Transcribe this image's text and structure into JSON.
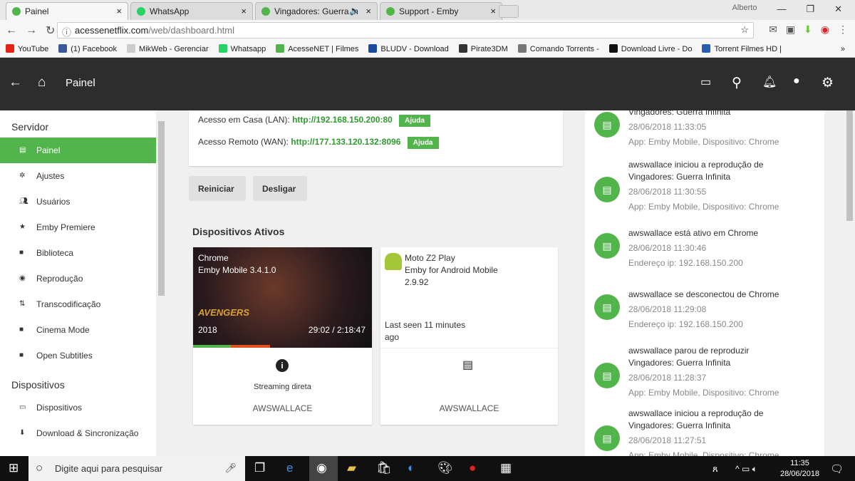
{
  "browser": {
    "tabs": [
      {
        "label": "Painel",
        "color": "#52b54b"
      },
      {
        "label": "WhatsApp",
        "color": "#25d366"
      },
      {
        "label": "Vingadores: Guerra In",
        "color": "#52b54b",
        "audio": "🔈"
      },
      {
        "label": "Support - Emby",
        "color": "#52b54b"
      }
    ],
    "user": "Alberto",
    "url_host": "acessenetflix.com",
    "url_path": "/web/dashboard.html",
    "bookmarks": [
      {
        "label": "YouTube",
        "color": "#e62117"
      },
      {
        "label": "(1) Facebook",
        "color": "#3b5998"
      },
      {
        "label": "MikWeb - Gerenciar",
        "color": "#ccc"
      },
      {
        "label": "Whatsapp",
        "color": "#25d366"
      },
      {
        "label": "AcesseNET | Filmes",
        "color": "#52b54b"
      },
      {
        "label": "BLUDV - Download",
        "color": "#1a4aa0"
      },
      {
        "label": "Pirate3DM",
        "color": "#333"
      },
      {
        "label": "Comando Torrents -",
        "color": "#777"
      },
      {
        "label": "Download Livre - Do",
        "color": "#111"
      },
      {
        "label": "Torrent Filmes HD |",
        "color": "#2a5db0"
      }
    ],
    "more": "»"
  },
  "header": {
    "title": "Painel"
  },
  "sidebar": {
    "server_heading": "Servidor",
    "server_items": [
      "Painel",
      "Ajustes",
      "Usuários",
      "Emby Premiere",
      "Biblioteca",
      "Reprodução",
      "Transcodificação",
      "Cinema Mode",
      "Open Subtitles"
    ],
    "devices_heading": "Dispositivos",
    "device_items": [
      "Dispositivos",
      "Download & Sincronização"
    ]
  },
  "server": {
    "lan_label": "Acesso em Casa (LAN):",
    "lan_url": "http://192.168.150.200:80",
    "wan_label": "Acesso Remoto (WAN):",
    "wan_url": "http://177.133.120.132:8096",
    "help": "Ajuda",
    "restart": "Reiniciar",
    "shutdown": "Desligar"
  },
  "devices": {
    "title": "Dispositivos Ativos",
    "items": [
      {
        "line1": "Chrome",
        "line2": "Emby Mobile 3.4.1.0",
        "year": "2018",
        "time": "29:02 / 2:18:47",
        "progress": 0.21,
        "transcode_progress": 0.43,
        "status": "Streaming direta",
        "user": "AWSWALLACE"
      },
      {
        "line1": "Moto Z2 Play",
        "line2": "Emby for Android Mobile",
        "line3": "2.9.92",
        "last_seen": "Last seen 11 minutes ago",
        "user": "AWSWALLACE"
      }
    ]
  },
  "activity": [
    {
      "title": "Vingadores: Guerra Infinita",
      "date": "28/06/2018 11:33:05",
      "detail": "App: Emby Mobile, Dispositivo: Chrome"
    },
    {
      "title": "awswallace iniciou a reprodução de Vingadores: Guerra Infinita",
      "date": "28/06/2018 11:30:55",
      "detail": "App: Emby Mobile, Dispositivo: Chrome"
    },
    {
      "title": "awswallace está ativo em Chrome",
      "date": "28/06/2018 11:30:46",
      "detail": "Endereço ip: 192.168.150.200"
    },
    {
      "title": "awswallace se desconectou de Chrome",
      "date": "28/06/2018 11:29:08",
      "detail": "Endereço ip: 192.168.150.200"
    },
    {
      "title": "awswallace parou de reproduzir Vingadores: Guerra Infinita",
      "date": "28/06/2018 11:28:37",
      "detail": "App: Emby Mobile, Dispositivo: Chrome"
    },
    {
      "title": "awswallace iniciou a reprodução de Vingadores: Guerra Infinita",
      "date": "28/06/2018 11:27:51",
      "detail": "App: Emby Mobile, Dispositivo: Chrome"
    }
  ],
  "taskbar": {
    "search_placeholder": "Digite aqui para pesquisar",
    "time": "11:35",
    "date": "28/06/2018"
  }
}
